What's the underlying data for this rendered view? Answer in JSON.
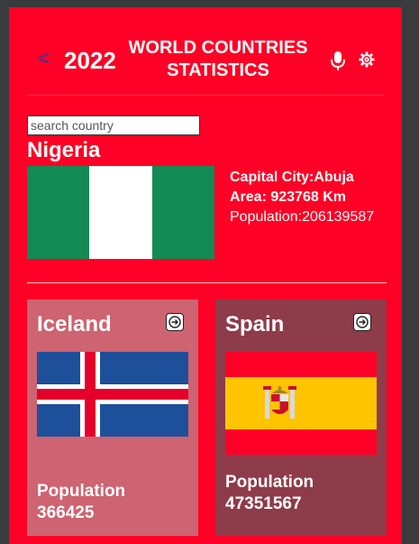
{
  "header": {
    "back_label": "<",
    "year": "2022",
    "title_line1": "WORLD COUNTRIES",
    "title_line2": "STATISTICS",
    "mic_icon": "microphone-icon",
    "settings_icon": "gear-icon"
  },
  "search": {
    "placeholder": "search country",
    "value": ""
  },
  "selected": {
    "name": "Nigeria",
    "capital": "Capital City:Abuja",
    "area": "Area: 923768 Km",
    "population": "Population:206139587",
    "flag_colors": [
      "#118a54",
      "#ffffff",
      "#118a54"
    ]
  },
  "cards": [
    {
      "name": "Iceland",
      "population_label": "Population",
      "population": "366425",
      "flag_colors": {
        "field": "#1e4f9a",
        "cross_outer": "#ffffff",
        "cross_inner": "#e4002b"
      },
      "card_color": "#ce6371"
    },
    {
      "name": "Spain",
      "population_label": "Population",
      "population": "47351567",
      "flag_colors": {
        "red": "#ff0026",
        "yellow": "#ffc400"
      },
      "card_color": "#8e3b4a"
    }
  ],
  "colors": {
    "app_bg": "#ff0026",
    "back_arrow": "#5b2b87",
    "outer_bg": "#3a3b3d"
  }
}
